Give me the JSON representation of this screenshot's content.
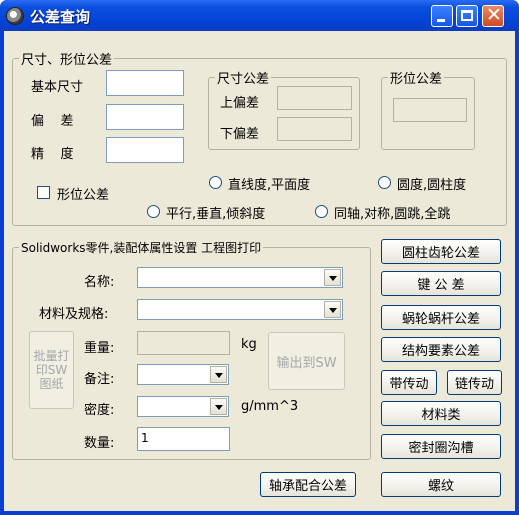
{
  "window": {
    "title": "公差查询"
  },
  "dimension_group": {
    "legend": "尺寸、形位公差",
    "basic_size_label": "基本尺寸",
    "deviation_label": "偏    差",
    "precision_label": "精    度",
    "basic_size_value": "",
    "deviation_value": "",
    "precision_value": "",
    "size_tol": {
      "legend": "尺寸公差",
      "upper_label": "上偏差",
      "lower_label": "下偏差",
      "upper_value": "",
      "lower_value": ""
    },
    "form_tol": {
      "legend": "形位公差",
      "value": ""
    },
    "form_checkbox_label": "形位公差",
    "radios": [
      "直线度,平面度",
      "圆度,圆柱度",
      "平行,垂直,倾斜度",
      "同轴,对称,圆跳,全跳"
    ]
  },
  "sw_group": {
    "legend": "Solidworks零件,装配体属性设置 工程图打印",
    "name_label": "名称:",
    "material_label": "材料及规格:",
    "weight_label": "重量:",
    "weight_unit": "kg",
    "note_label": "备注:",
    "density_label": "密度:",
    "density_unit": "g/mm^3",
    "qty_label": "数量:",
    "qty_value": "1",
    "name_value": "",
    "material_value": "",
    "weight_value": "",
    "note_value": "",
    "density_value": "",
    "batch_print_btn": "批量打印SW图纸",
    "export_btn": "输出到SW"
  },
  "right_buttons": [
    "圆柱齿轮公差",
    "键 公 差",
    "蜗轮蜗杆公差",
    "结构要素公差",
    "带传动",
    "链传动",
    "材料类",
    "密封圈沟槽"
  ],
  "bottom_buttons": {
    "bearing": "轴承配合公差",
    "thread": "螺纹"
  },
  "colors": {
    "titlebar": "#0542d4",
    "face": "#ece9d8",
    "close_button": "#cf4a22"
  }
}
